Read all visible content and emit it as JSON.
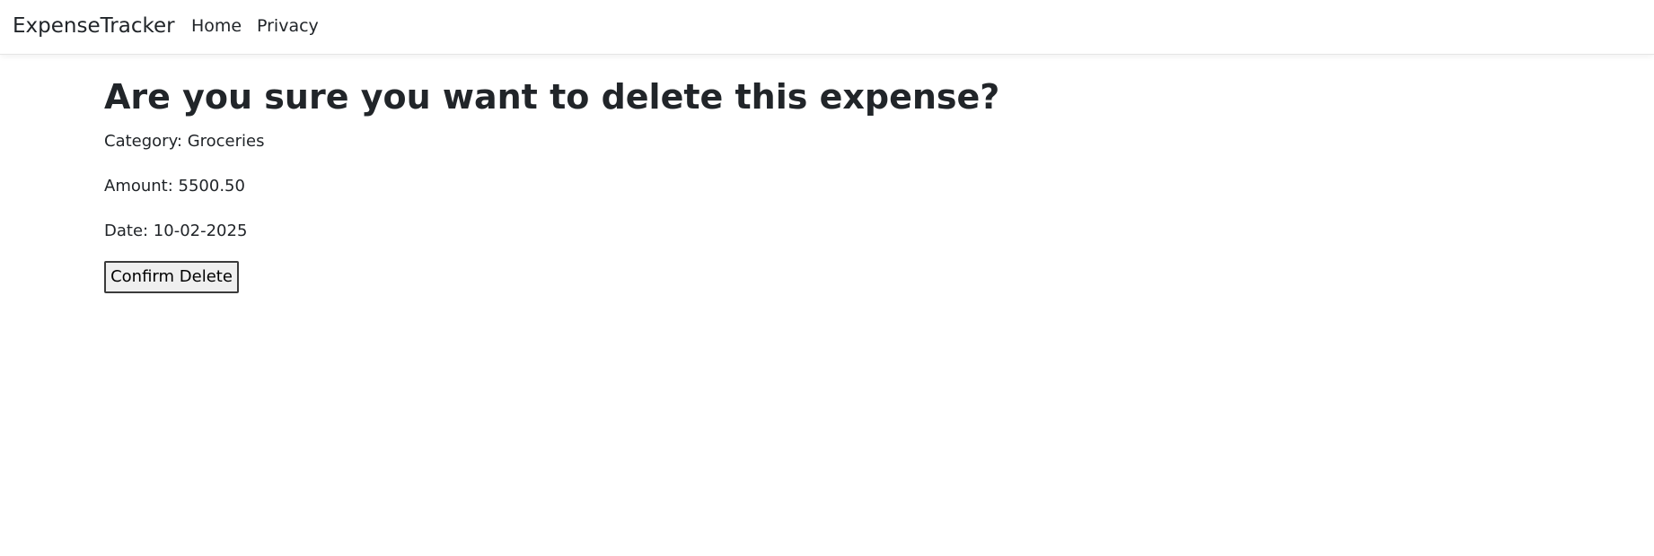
{
  "navbar": {
    "brand": "ExpenseTracker",
    "links": [
      {
        "label": "Home"
      },
      {
        "label": "Privacy"
      }
    ]
  },
  "main": {
    "title": "Are you sure you want to delete this expense?",
    "category_text": "Category: Groceries",
    "amount_text": "Amount: 5500.50",
    "date_text": "Date: 10-02-2025",
    "confirm_button_label": "Confirm Delete"
  },
  "colors": {
    "text": "#212529",
    "background": "#ffffff",
    "button_bg": "#efefef",
    "button_border": "#3b3b3b"
  }
}
